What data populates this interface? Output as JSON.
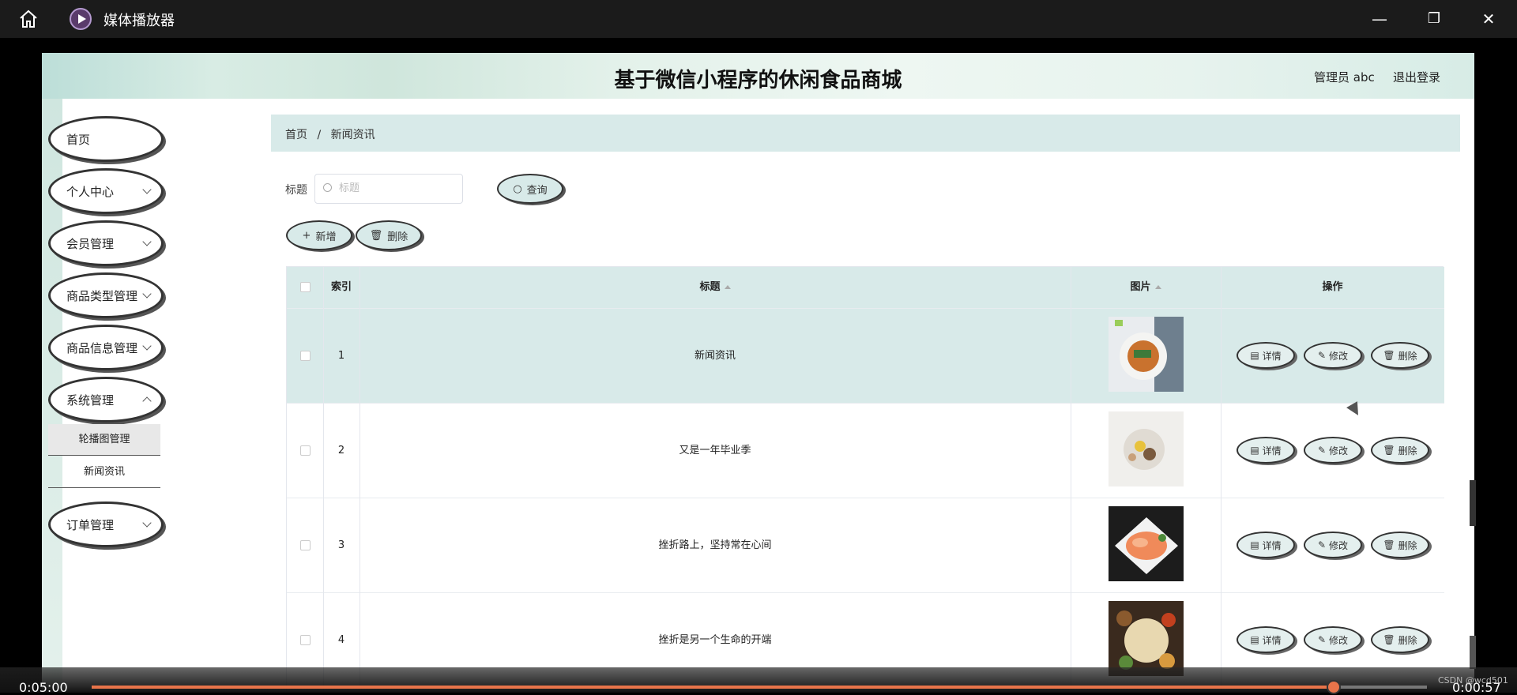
{
  "player": {
    "title": "媒体播放器",
    "elapsed": "0:05:00",
    "remaining": "0:00:57",
    "progress": 0.93,
    "watermark": "CSDN @wcd501",
    "buttons": {
      "minimize": "—",
      "restore": "❐",
      "close": "✕"
    }
  },
  "site": {
    "title": "基于微信小程序的休闲食品商城",
    "admin": "管理员 abc",
    "logout": "退出登录"
  },
  "sidebar": {
    "items": [
      {
        "label": "首页",
        "has_arrow": false
      },
      {
        "label": "个人中心",
        "has_arrow": true
      },
      {
        "label": "会员管理",
        "has_arrow": true
      },
      {
        "label": "商品类型管理",
        "has_arrow": true
      },
      {
        "label": "商品信息管理",
        "has_arrow": true
      },
      {
        "label": "系统管理",
        "has_arrow": true
      }
    ],
    "sub_items": [
      "轮播图管理",
      "新闻资讯"
    ],
    "last_item": {
      "label": "订单管理",
      "has_arrow": true
    }
  },
  "breadcrumb": {
    "home": "首页",
    "sep": "/",
    "current": "新闻资讯"
  },
  "search": {
    "label": "标题",
    "placeholder": "标题",
    "query_button": "查询"
  },
  "toolbar": {
    "add": "新增",
    "delete": "删除"
  },
  "table": {
    "headers": {
      "index": "索引",
      "title": "标题",
      "image": "图片",
      "actions": "操作"
    },
    "action_labels": {
      "detail": "详情",
      "edit": "修改",
      "delete": "删除"
    },
    "rows": [
      {
        "index": "1",
        "title": "新闻资讯",
        "highlight": true
      },
      {
        "index": "2",
        "title": "又是一年毕业季",
        "highlight": false
      },
      {
        "index": "3",
        "title": "挫折路上，坚持常在心间",
        "highlight": false
      },
      {
        "index": "4",
        "title": "挫折是另一个生命的开端",
        "highlight": false
      }
    ]
  },
  "colors": {
    "accent": "#d8eae9",
    "progress": "#e8744a"
  }
}
